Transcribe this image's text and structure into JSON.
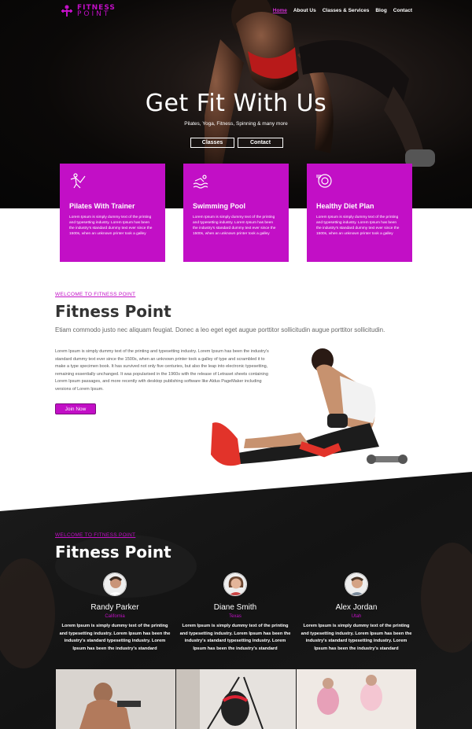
{
  "brand": {
    "line1": "FITNESS",
    "line2": "POINT",
    "color": "#c20fc6"
  },
  "nav": [
    {
      "label": "Home",
      "active": true
    },
    {
      "label": "About Us"
    },
    {
      "label": "Classes & Services"
    },
    {
      "label": "Blog"
    },
    {
      "label": "Contact"
    }
  ],
  "hero": {
    "title": "Get Fit With Us",
    "subtitle": "Pilates, Yoga, Fitness, Spinning & many more",
    "btn_classes": "Classes",
    "btn_contact": "Contact"
  },
  "cards": [
    {
      "icon": "pilates-icon",
      "title": "Pilates With Trainer",
      "text": "Lorem Ipsum is simply dummy text of the printing and typesetting industry. Lorem Ipsum has been the industry's standard dummy text ever since the 1500s, when an unknown printer took a galley"
    },
    {
      "icon": "swimming-icon",
      "title": "Swimming Pool",
      "text": "Lorem Ipsum is simply dummy text of the printing and typesetting industry. Lorem Ipsum has been the industry's standard dummy text ever since the 1500s, when an unknown printer took a galley"
    },
    {
      "icon": "diet-icon",
      "title": "Healthy Diet Plan",
      "text": "Lorem Ipsum is simply dummy text of the printing and typesetting industry. Lorem Ipsum has been the industry's standard dummy text ever since the 1500s, when an unknown printer took a galley"
    }
  ],
  "about": {
    "welcome": "WELCOME TO FITNESS POINT",
    "title": "Fitness Point",
    "lead": "Etiam commodo justo nec aliquam feugiat. Donec a leo eget eget augue porttitor sollicitudin augue porttitor sollicitudin.",
    "body": "Lorem Ipsum is simply dummy text of the printing and typesetting industry. Lorem Ipsum has been the industry's standard dummy text ever since the 1500s, when an unknown printer took a galley of type and scrambled it to make a type specimen book. It has survived not only five centuries, but also the leap into electronic typesetting, remaining essentially unchanged. It was popularised in the 1960s with the release of Letraset sheets containing Lorem Ipsum passages, and more recently with desktop publishing software like Aldus PageMaker including versions of Lorem Ipsum.",
    "join": "Join Now"
  },
  "team": {
    "welcome": "WELCOME TO FITNESS POINT",
    "title": "Fitness Point",
    "members": [
      {
        "name": "Randy Parker",
        "location": "California",
        "text": "Lorem Ipsum is simply dummy text of the printing and typesetting industry. Lorem Ipsum has been the industry's standard typesetting industry. Lorem Ipsum has been the industry's standard"
      },
      {
        "name": "Diane Smith",
        "location": "Texas",
        "text": "Lorem Ipsum is simply dummy text of the printing and typesetting industry. Lorem Ipsum has been the industry's standard typesetting industry. Lorem Ipsum has been the industry's standard"
      },
      {
        "name": "Alex Jordan",
        "location": "Utah",
        "text": "Lorem Ipsum is simply dummy text of the printing and typesetting industry. Lorem Ipsum has been the industry's standard typesetting industry. Lorem Ipsum has been the industry's standard"
      }
    ]
  }
}
